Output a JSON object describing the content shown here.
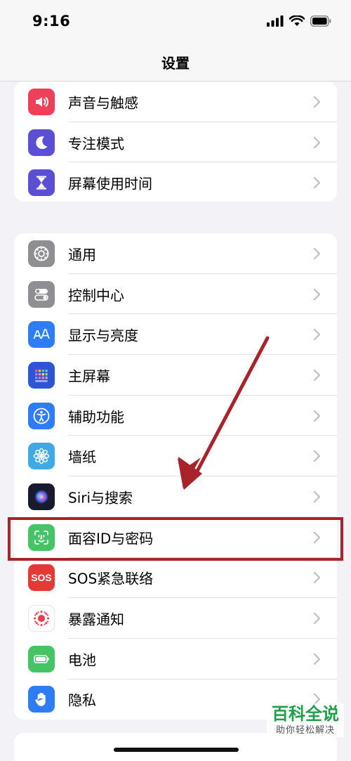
{
  "status_bar": {
    "time": "9:16"
  },
  "nav": {
    "title": "设置"
  },
  "group1": [
    {
      "label": "声音与触感",
      "icon": "speaker-icon",
      "color": "#ee4059"
    },
    {
      "label": "专注模式",
      "icon": "moon-icon",
      "color": "#5b4fd6"
    },
    {
      "label": "屏幕使用时间",
      "icon": "hourglass-icon",
      "color": "#5b4fd6"
    }
  ],
  "group2": [
    {
      "label": "通用",
      "icon": "gear-icon",
      "color": "#8e8e93"
    },
    {
      "label": "控制中心",
      "icon": "toggles-icon",
      "color": "#8e8e93"
    },
    {
      "label": "显示与亮度",
      "icon": "text-size-icon",
      "color": "#2f7df6"
    },
    {
      "label": "主屏幕",
      "icon": "home-grid-icon",
      "color": "#2f55d4"
    },
    {
      "label": "辅助功能",
      "icon": "accessibility-icon",
      "color": "#2f7df6"
    },
    {
      "label": "墙纸",
      "icon": "flower-icon",
      "color": "#3fa9e6"
    },
    {
      "label": "Siri与搜索",
      "icon": "siri-icon",
      "color": "#1a1a2e"
    },
    {
      "label": "面容ID与密码",
      "icon": "face-id-icon",
      "color": "#45c466"
    },
    {
      "label": "SOS紧急联络",
      "icon": "sos-icon",
      "color": "#e53935"
    },
    {
      "label": "暴露通知",
      "icon": "exposure-icon",
      "color": "#ffffff"
    },
    {
      "label": "电池",
      "icon": "battery-icon",
      "color": "#45c466"
    },
    {
      "label": "隐私",
      "icon": "hand-icon",
      "color": "#2f7df6"
    }
  ],
  "sos_text": "SOS",
  "watermark": {
    "main": "百科全说",
    "sub": "助你轻松解决"
  }
}
